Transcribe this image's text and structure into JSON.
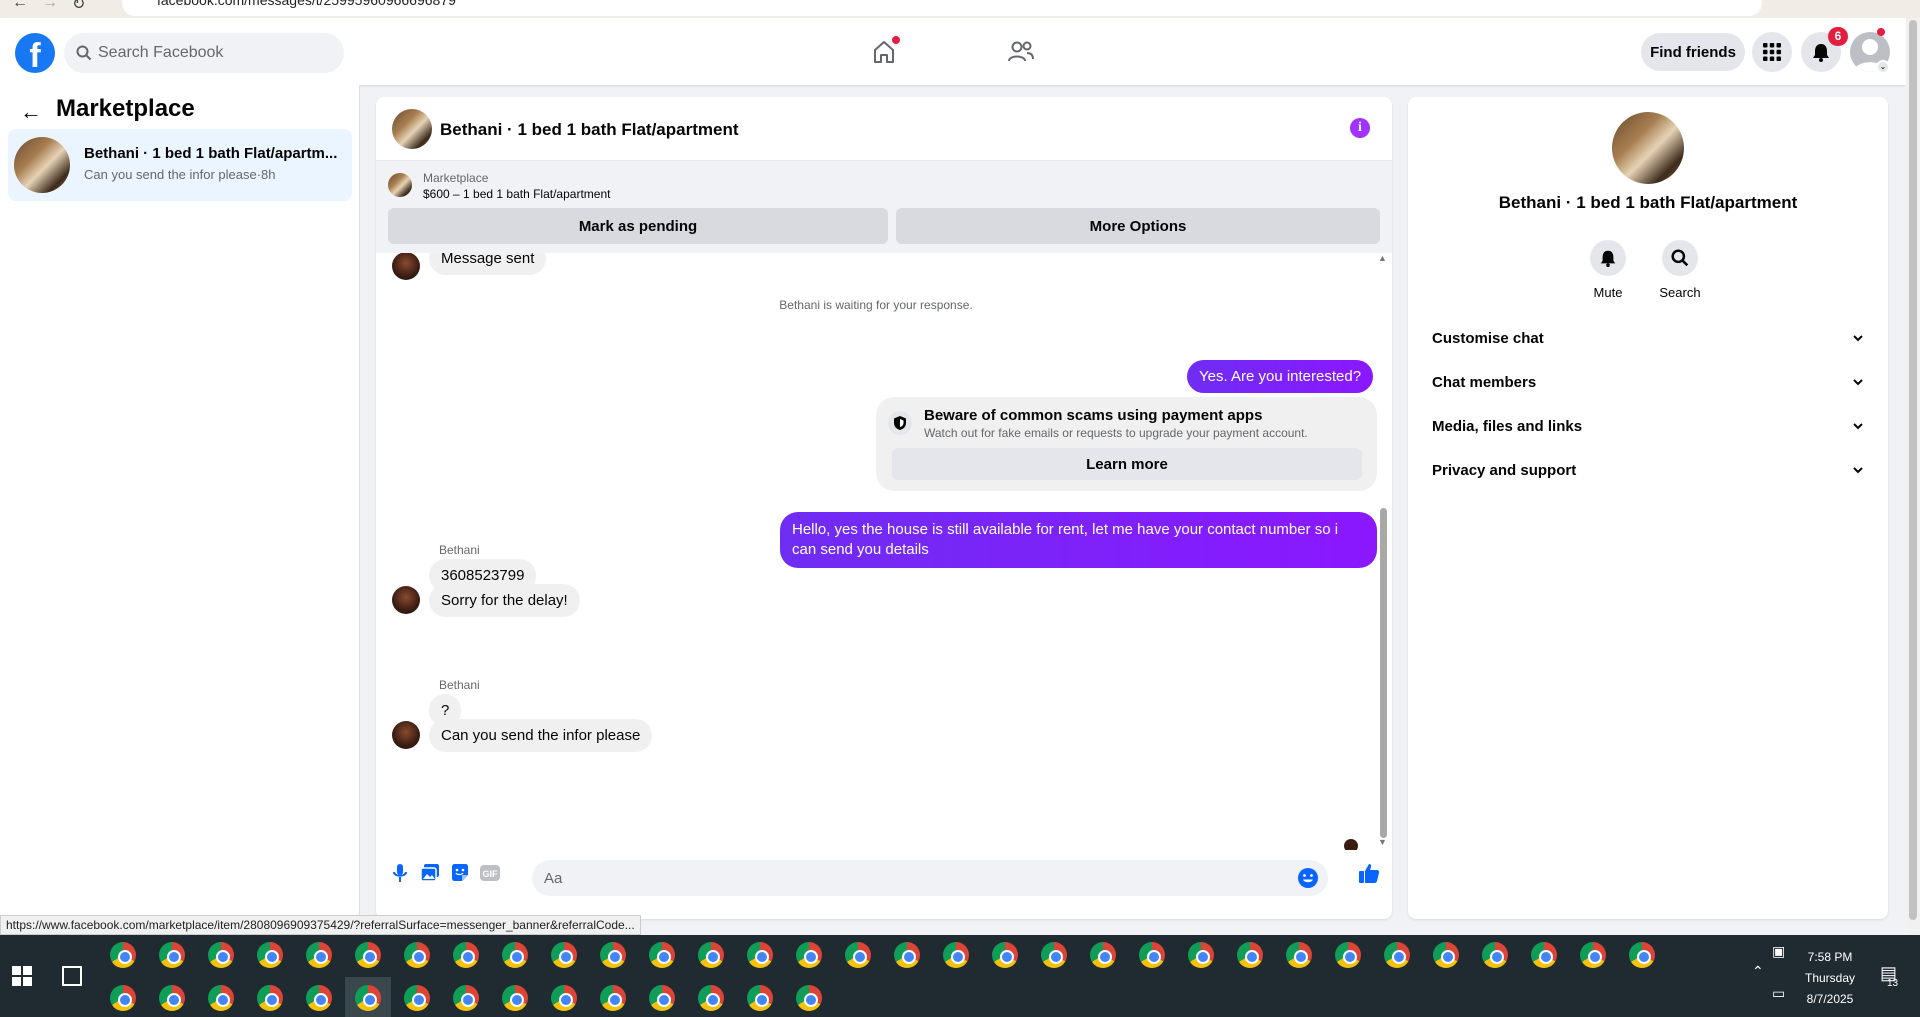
{
  "browser": {
    "url": "facebook.com/messages/t/25995960966696879"
  },
  "header": {
    "logo": "f",
    "search_placeholder": "Search Facebook",
    "find_friends": "Find friends",
    "notification_count": "6",
    "icons": [
      "home-icon",
      "friends-icon",
      "menu-grid-icon",
      "bell-icon",
      "profile-avatar"
    ]
  },
  "sidebar": {
    "title": "Marketplace",
    "conversation": {
      "name": "Bethani · 1 bed 1 bath Flat/apartm...",
      "preview": "Can you send the infor please·8h"
    }
  },
  "chat": {
    "title": "Bethani · 1 bed 1 bath Flat/apartment",
    "banner": {
      "label": "Marketplace",
      "listing": "$600 – 1 bed 1 bath Flat/apartment",
      "pending_button": "Mark as pending",
      "more_button": "More Options"
    },
    "messages": {
      "partial_top": "Message sent",
      "status": "Bethani is waiting for your response.",
      "out_1": "Yes. Are you interested?",
      "scam_title": "Beware of common scams using payment apps",
      "scam_subtitle": "Watch out for fake emails or requests to upgrade your payment account.",
      "learn_more": "Learn more",
      "out_2": "Hello, yes the house is still available for rent, let me have your contact number so i can send you details",
      "sender_1": "Bethani",
      "in_1": "3608523799",
      "in_2": "Sorry for the delay!",
      "sender_2": "Bethani",
      "in_3": "?",
      "in_4": "Can you send the infor please"
    },
    "composer": {
      "placeholder": "Aa"
    }
  },
  "details": {
    "title": "Bethani · 1 bed 1 bath Flat/apartment",
    "mute": "Mute",
    "search": "Search",
    "sections": [
      "Customise chat",
      "Chat members",
      "Media, files and links",
      "Privacy and support"
    ]
  },
  "status_url": "https://www.facebook.com/marketplace/item/2808096909375429/?referralSurface=messenger_banner&referralCode...",
  "taskbar": {
    "time": "7:58 PM",
    "day": "Thursday",
    "date": "8/7/2025",
    "notification_count": "13"
  },
  "colors": {
    "brand": "#1877f2",
    "outgoing_bubble": "#7b1ff0",
    "badge": "#e41e3f"
  }
}
